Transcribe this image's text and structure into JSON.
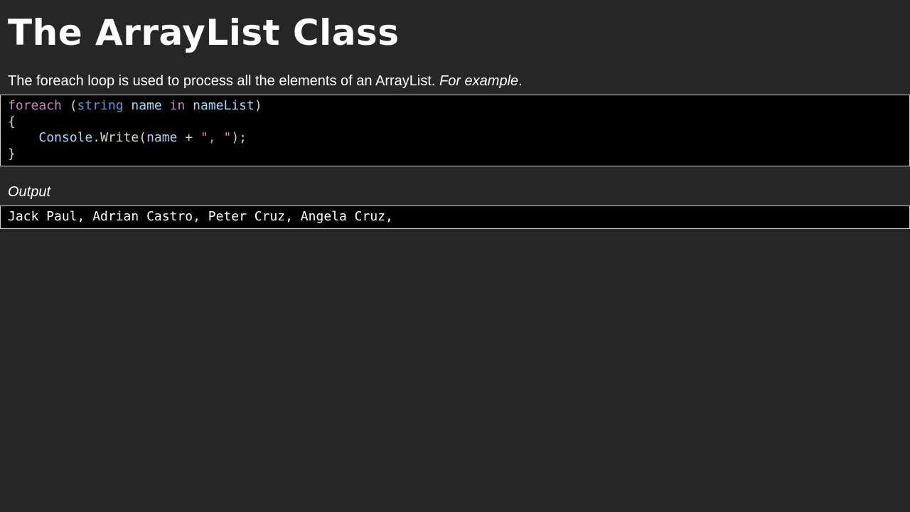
{
  "title": "The ArrayList Class",
  "intro": {
    "text": "The foreach loop is used to process all the elements of an ArrayList. ",
    "emphasis": "For example",
    "trailing": "."
  },
  "code": {
    "line1": {
      "keyword_foreach": "foreach",
      "open_paren": " (",
      "type_string": "string",
      "space1": " ",
      "var_name": "name",
      "space2": " ",
      "keyword_in": "in",
      "space3": " ",
      "var_list": "nameList",
      "close_paren": ")"
    },
    "line2": "{",
    "line3": {
      "indent": "    ",
      "class_console": "Console",
      "dot": ".",
      "method_write": "Write",
      "open_paren": "(",
      "var_name": "name",
      "plus": " + ",
      "string_literal": "\", \"",
      "close": ");"
    },
    "line4": "}"
  },
  "output": {
    "label": "Output",
    "text": "Jack Paul, Adrian Castro, Peter Cruz, Angela Cruz,"
  },
  "colors": {
    "background": "#262626",
    "code_background": "#000000",
    "keyword": "#c586c0",
    "type": "#569cd6",
    "variable": "#9cdcfe",
    "method": "#dcdcaa",
    "string": "#ce9178"
  }
}
